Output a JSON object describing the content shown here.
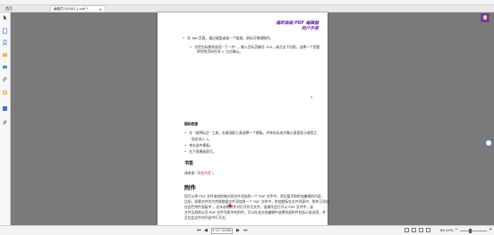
{
  "tabs": {
    "home": "首页",
    "document": "编程员150002上.pdf *",
    "close_glyph": "×"
  },
  "page": {
    "header_title_line1": "福昕高级 PDF 编辑器",
    "header_title_line2": "用户手册",
    "top_lines": [
      "在 Tab 页面，通过键盘或某一个链接，鼠标可按键操作。",
      "先把光标移到选项 “下一节” ，输入目标页编号 100，或点击下拉框，选择一个您要",
      "转到的页码在项 > 点击确认。"
    ],
    "page_number": "9",
    "section_small_heading": "图标检查",
    "bullets": [
      "在 “选择标注” 工具，右键选取工具选择一个模板，并单击标准对象以直接显示使用之",
      "指名进入 1。",
      "单击选中模板。",
      "右下角模板即可。"
    ],
    "bookmark_heading": "书签",
    "bookmark_text_prefix": "请参阅 “",
    "bookmark_link": "添加书签",
    "bookmark_text_suffix": "”。",
    "attachment_heading": "附件",
    "attachment_lines": [
      "您可以将 PDF 文件或其他格式的文件添加到一个 PDF 文件中，然后整页和附加编辑的内容，",
      "比如，如果文件作为特殊数据文件添加到一个 PDF 文件中，附加就标在文件列表中，附件可添加",
      "在此栏附件面板中         ，还未说明附件对打开作为文件，该操作会打开以 PDF 文件中，该",
      "文件及其他公司 PDF 文件列表中的附件，可以在该文档编辑中选择所选附件包括以该选项，并",
      "且在此文件的列出中打开文。"
    ]
  },
  "status": {
    "first_glyph": "⏮",
    "prev_glyph": "◀",
    "page_field": "9 (1 / 2000)",
    "next_glyph": "▶",
    "last_glyph": "⏭",
    "zoom": "86.49%",
    "zoom_minus": "−",
    "zoom_plus": "+"
  },
  "icons": {
    "sidebar": [
      "cursor-icon",
      "page-icon",
      "bookmark-icon",
      "layers-icon",
      "comment-icon",
      "attachment-icon",
      "signature-icon",
      "search-icon",
      "paperclip-icon"
    ],
    "assistant": "ai-assistant-icon"
  },
  "colors": {
    "header_title": "#6a2ca8",
    "link": "#c03030",
    "assistant": "#6a3fa0"
  }
}
